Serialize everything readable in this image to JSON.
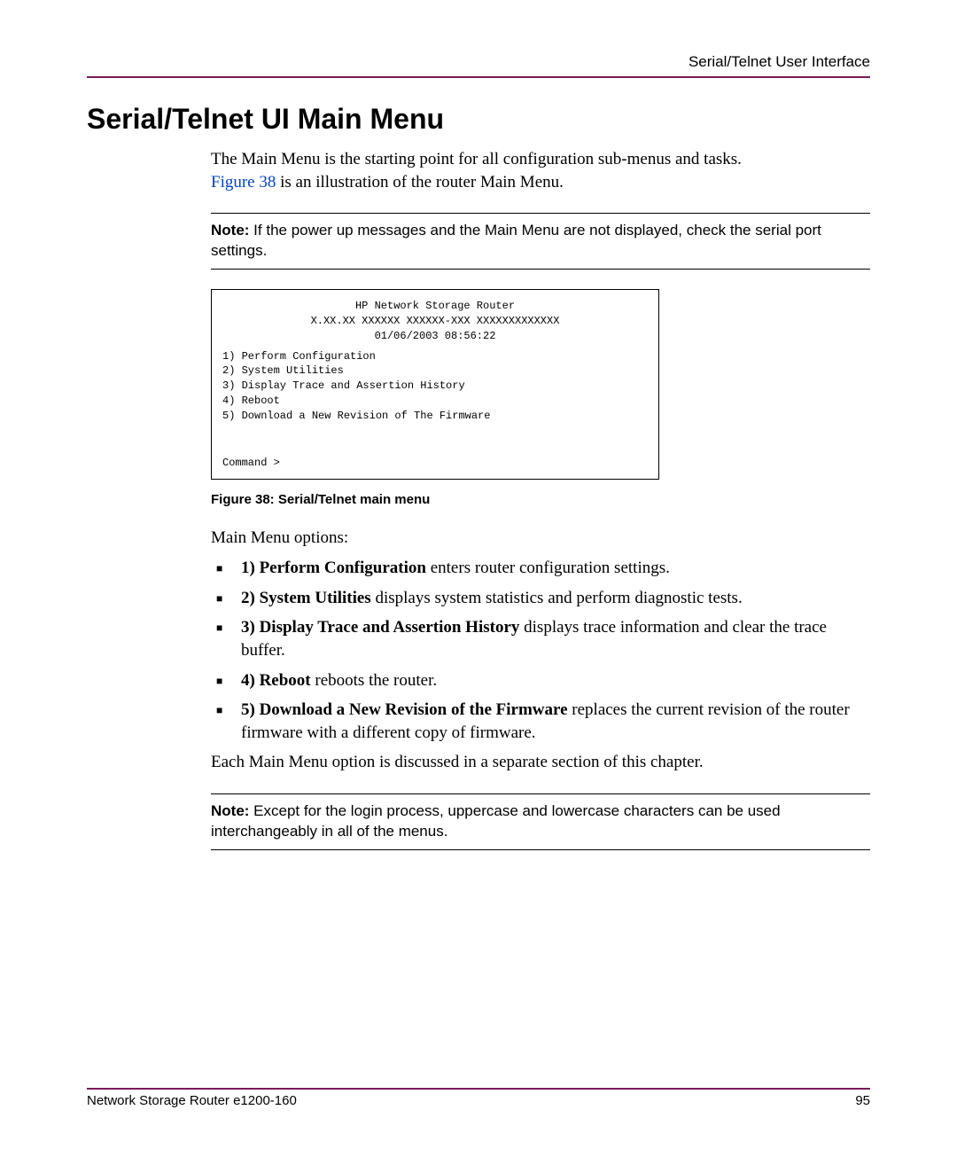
{
  "header": {
    "right": "Serial/Telnet User Interface"
  },
  "title": "Serial/Telnet UI Main Menu",
  "intro": {
    "line1": "The Main Menu is the starting point for all configuration sub-menus and tasks.",
    "figref": "Figure 38",
    "line2_rest": " is an illustration of the router Main Menu."
  },
  "note1": {
    "label": "Note:",
    "text": "  If the power up messages and the Main Menu are not displayed, check the serial port settings."
  },
  "terminal": {
    "title": "HP Network Storage Router",
    "version": "X.XX.XX  XXXXXX  XXXXXX-XXX XXXXXXXXXXXXX",
    "timestamp": "01/06/2003  08:56:22",
    "items": [
      "1) Perform Configuration",
      "2) System Utilities",
      "3) Display Trace and Assertion History",
      "4) Reboot",
      "5) Download a New Revision of The Firmware"
    ],
    "prompt": "Command >"
  },
  "figcaption": "Figure 38:  Serial/Telnet main menu",
  "options_intro": "Main Menu options:",
  "options": [
    {
      "label": "1) Perform Configuration",
      "desc": " enters router configuration settings."
    },
    {
      "label": "2) System Utilities",
      "desc": " displays system statistics and perform diagnostic tests."
    },
    {
      "label": "3) Display Trace and Assertion History",
      "desc": " displays trace information and clear the trace buffer."
    },
    {
      "label": "4) Reboot",
      "desc": " reboots the router."
    },
    {
      "label": "5) Download a New Revision of the Firmware",
      "desc": " replaces the current revision of the router firmware with a different copy of firmware."
    }
  ],
  "closing": "Each Main Menu option is discussed in a separate section of this chapter.",
  "note2": {
    "label": "Note:",
    "text": "  Except for the login process, uppercase and lowercase characters can be used interchangeably in all of the menus."
  },
  "footer": {
    "left": "Network Storage Router e1200-160",
    "right": "95"
  }
}
